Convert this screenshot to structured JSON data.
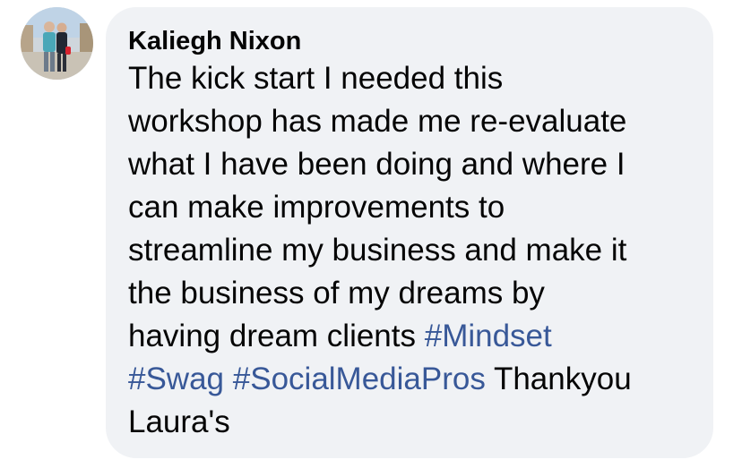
{
  "comment": {
    "author": "Kaliegh Nixon",
    "lines": [
      "The kick start I needed this",
      "workshop has made me re-evaluate",
      "what I have been doing and where I",
      "can make improvements to",
      "streamline my business and make it",
      "the business of my dreams by"
    ],
    "line7_text": "having dream clients ",
    "hashtags": [
      "#Mindset",
      "#Swag",
      "#SocialMediaPros"
    ],
    "line8_trailing": " Thankyou",
    "line9_text": "Laura's"
  },
  "colors": {
    "bubble_bg": "#f0f2f5",
    "text": "#050505",
    "hashtag": "#385898"
  },
  "icons": {
    "avatar": "profile-photo"
  }
}
